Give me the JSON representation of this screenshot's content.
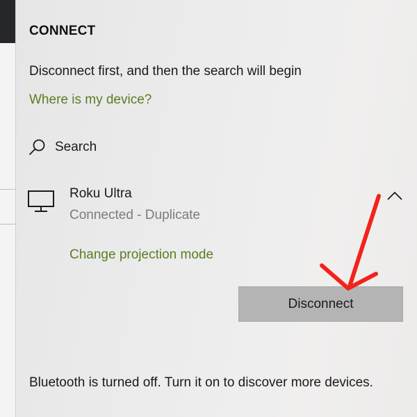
{
  "panel": {
    "title": "CONNECT",
    "hint": "Disconnect first, and then the search will begin",
    "where_link": "Where is my device?",
    "search": {
      "label": "Search",
      "icon": "search-icon"
    },
    "device": {
      "name": "Roku Ultra",
      "status": "Connected - Duplicate",
      "icon": "monitor-icon",
      "expand_icon": "chevron-up-icon"
    },
    "change_link": "Change projection mode",
    "disconnect_label": "Disconnect",
    "bluetooth_text": "Bluetooth is turned off. Turn it on to discover more devices."
  },
  "colors": {
    "link": "#5a7d1f",
    "status": "#7b7b7b",
    "button": "#b4b4b4",
    "annotation_arrow": "#f2231a"
  }
}
